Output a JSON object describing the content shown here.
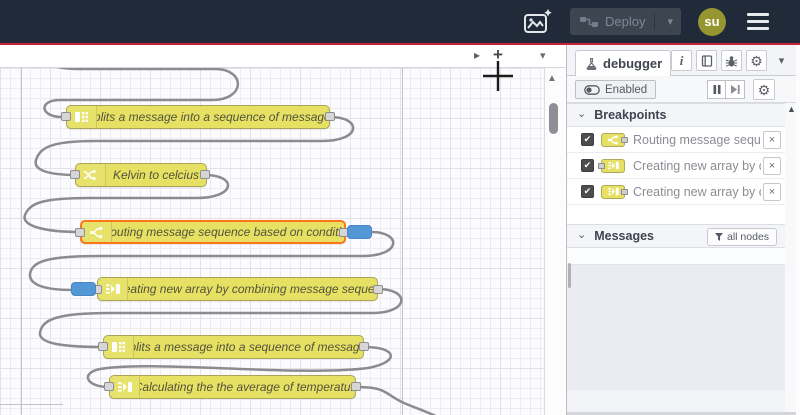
{
  "header": {
    "deploy": {
      "label": "Deploy"
    },
    "avatar": {
      "label": "su"
    }
  },
  "canvas": {
    "nodes": [
      {
        "type": "split",
        "label": "Splits a message into a sequence of messages."
      },
      {
        "type": "change",
        "label": "Kelvin to celcius"
      },
      {
        "type": "switch",
        "label": "Routing message sequence based on condition",
        "selected": true,
        "breakpoint_on_output": true
      },
      {
        "type": "join",
        "label": "Creating new array by combining message sequence",
        "breakpoint_on_input": true
      },
      {
        "type": "split",
        "label": "Splits a message into a sequence of messages."
      },
      {
        "type": "join",
        "label": "Calculating the the average of temperature"
      }
    ]
  },
  "sidebar": {
    "tab": {
      "label": "debugger"
    },
    "toolbar": {
      "enabled_label": "Enabled"
    },
    "breakpoints": {
      "title": "Breakpoints",
      "items": [
        {
          "label": "Routing message sequence ba",
          "checked": true
        },
        {
          "label": "Creating new array by combini",
          "checked": true
        },
        {
          "label": "Creating new array by combini",
          "checked": true
        }
      ]
    },
    "messages": {
      "title": "Messages",
      "filter_label": "all nodes"
    }
  },
  "icons": {
    "check": "✔",
    "close": "×",
    "section_chevron": "⌄",
    "dropdown_chevron": "▾",
    "tab_scroll_play": "▸",
    "add_tab": "+",
    "scroll_up_arrow": "▲",
    "gear": "⚙",
    "info": "i"
  },
  "colors": {
    "header_bg": "#212a38",
    "accent_red": "#c5223d",
    "node_yellow": "#e6e162",
    "selected_orange": "#ff7519",
    "breakpoint_blue": "#5397d7",
    "wire_gray": "#8b8b90"
  }
}
